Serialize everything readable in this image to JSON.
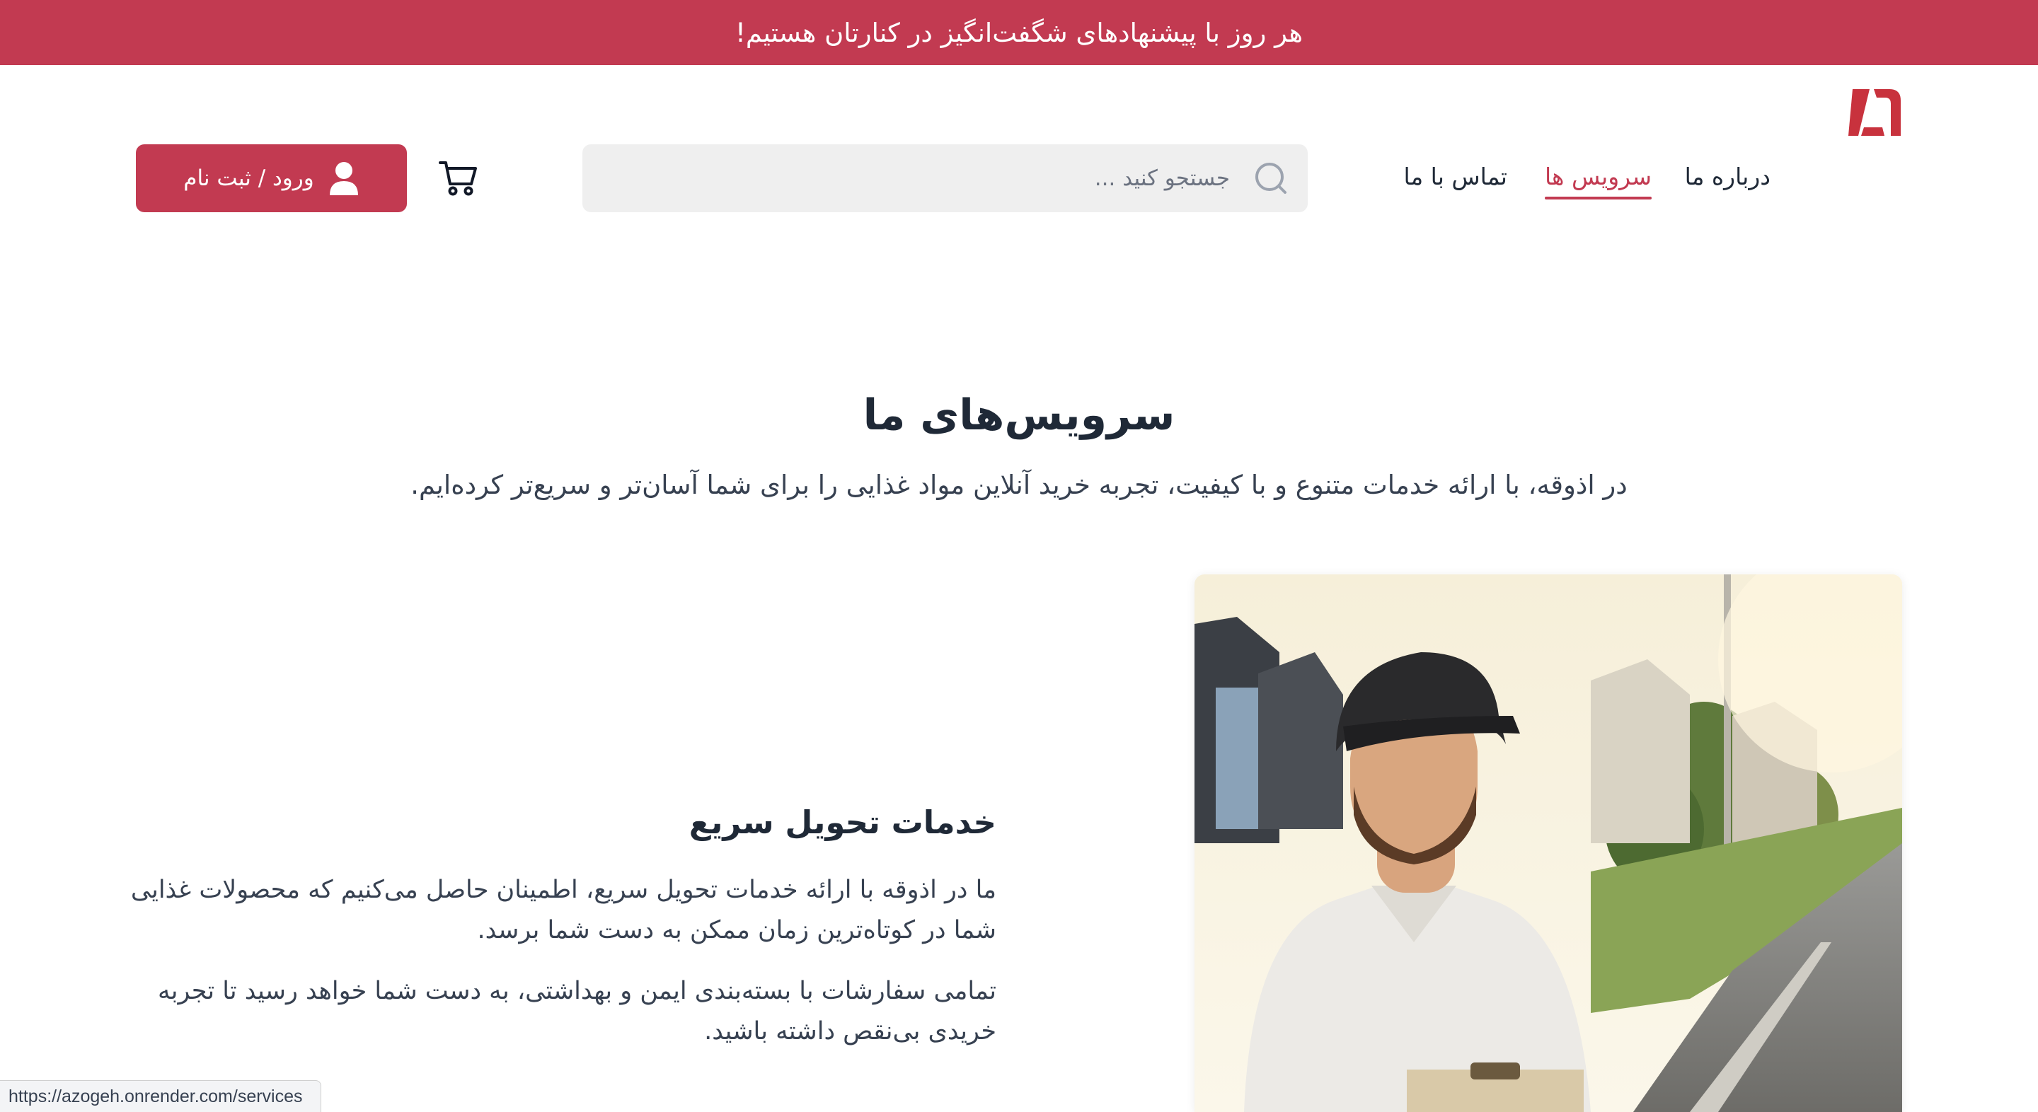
{
  "promo_banner": {
    "text": "هر روز با پیشنهادهای شگفت‌انگیز در کنارتان هستیم!"
  },
  "header": {
    "logo_icon": "azogeh-logo-icon",
    "nav": [
      {
        "label": "درباره ما",
        "active": false
      },
      {
        "label": "سرویس ها",
        "active": true
      },
      {
        "label": "تماس با ما",
        "active": false
      }
    ],
    "search": {
      "placeholder": "جستجو کنید ...",
      "value": "",
      "icon": "search-icon"
    },
    "cart_icon": "cart-icon",
    "login": {
      "label": "ورود / ثبت نام",
      "icon": "user-icon"
    }
  },
  "hero": {
    "title": "سرویس‌های ما",
    "subtitle": "در اذوقه، با ارائه خدمات متنوع و با کیفیت، تجربه خرید آنلاین مواد غذایی را برای شما آسان‌تر و سریع‌تر کرده‌ایم."
  },
  "service": {
    "title": "خدمات تحویل سریع",
    "paragraph_1": "ما در اذوقه با ارائه خدمات تحویل سریع، اطمینان حاصل می‌کنیم که محصولات غذایی شما در کوتاه‌ترین زمان ممکن به دست شما برسد.",
    "paragraph_2": "تمامی سفارشات با بسته‌بندی ایمن و بهداشتی، به دست شما خواهد رسید تا تجربه خریدی بی‌نقص داشته باشید.",
    "image": "delivery-man-photo"
  },
  "status_bar": {
    "url": "https://azogeh.onrender.com/services"
  },
  "colors": {
    "brand": "#c23a51",
    "text": "#1f2937",
    "search_bg": "#efefef"
  }
}
